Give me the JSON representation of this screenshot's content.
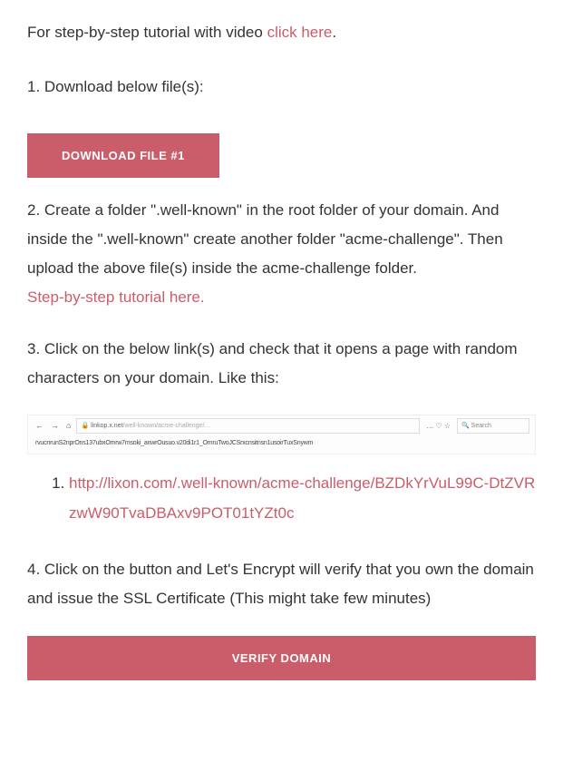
{
  "intro": {
    "prefix": "For step-by-step tutorial with video ",
    "link": "click here",
    "suffix": "."
  },
  "step1": {
    "text": "1. Download below file(s):",
    "button": "DOWNLOAD FILE #1"
  },
  "step2": {
    "text": "2. Create a folder \".well-known\" in the root folder of your domain. And inside the \".well-known\" create another folder \"acme-challenge\". Then upload the above file(s) inside the acme-challenge folder.",
    "link": "Step-by-step tutorial here."
  },
  "step3": {
    "text": "3. Click on the below link(s) and check that it opens a page with random characters on your domain. Like this:",
    "browser": {
      "url_bar_prefix": "🔒 linkop.x.net",
      "url_bar_path": "/well-known/acme-challenge/…",
      "search_placeholder": "Search",
      "body_chars": "rvucnrunS2nprOns137ubxOmrw7msoki_anwrOusuo.v20di1r1_OmruTwoJCSrxcnsitnsn1usoirTuxSnywm"
    },
    "url_item": "http://lixon.com/.well-known/acme-challenge/BZDkYrVuL99C-DtZVRzwW90TvaDBAxv9POT01tYZt0c"
  },
  "step4": {
    "text": "4. Click on the button and Let's Encrypt will verify that you own the domain and issue the SSL Certificate (This might take few minutes)",
    "button": "VERIFY DOMAIN"
  }
}
